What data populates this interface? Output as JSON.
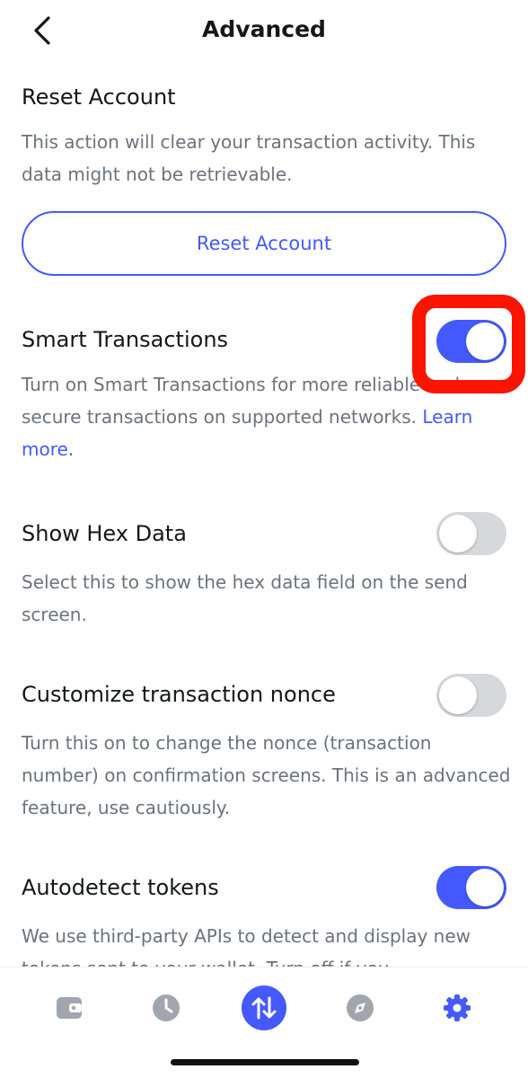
{
  "header": {
    "title": "Advanced",
    "back_icon": "chevron-left-icon"
  },
  "reset": {
    "title": "Reset Account",
    "description": "This action will clear your transaction activity. This data might not be retrievable.",
    "button_label": "Reset Account"
  },
  "smart_transactions": {
    "title": "Smart Transactions",
    "description": "Turn on Smart Transactions for more reliable and secure transactions on supported networks.",
    "link_label": "Learn more.",
    "enabled": true
  },
  "hex_data": {
    "title": "Show Hex Data",
    "description": "Select this to show the hex data field on the send screen.",
    "enabled": false
  },
  "nonce": {
    "title": "Customize transaction nonce",
    "description": "Turn this on to change the nonce (transaction number) on confirmation screens. This is an advanced feature, use cautiously.",
    "enabled": false
  },
  "autodetect": {
    "title": "Autodetect tokens",
    "description": "We use third-party APIs to detect and display new tokens sent to your wallet. Turn off if you",
    "enabled": true
  },
  "tabbar": {
    "tabs": [
      {
        "icon": "wallet-icon",
        "active": false
      },
      {
        "icon": "clock-icon",
        "active": false
      },
      {
        "icon": "swap-arrows-icon",
        "active": false
      },
      {
        "icon": "compass-icon",
        "active": false
      },
      {
        "icon": "gear-icon",
        "active": true
      }
    ]
  },
  "colors": {
    "accent": "#4459ff",
    "highlight": "#fb1400",
    "muted": "#6a737d",
    "toggle_off": "#d6d9dc"
  }
}
